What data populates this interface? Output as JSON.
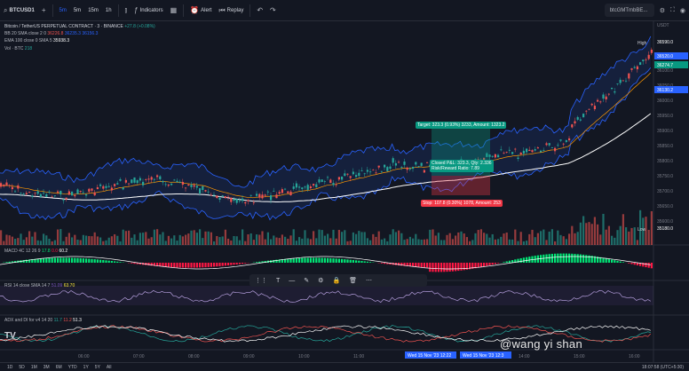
{
  "toolbar": {
    "symbol": "BTCUSD1",
    "intervals": [
      "5m",
      "5m",
      "15m",
      "1h"
    ],
    "indicators": "Indicators",
    "alert": "Alert",
    "replay": "Replay",
    "search": "btcGMTmbBE...",
    "icons": [
      "menu-icon",
      "candles-icon",
      "layout-icon",
      "undo-icon",
      "redo-icon",
      "settings-icon",
      "fullscreen-icon",
      "camera-icon"
    ]
  },
  "legend": {
    "title": "Bitcoin / TetherUS PERPETUAL CONTRACT · 3 · BINANCE",
    "title_change": "+27.8 (+0.08%)",
    "bb": "BB  20 SMA close 2 0",
    "bb_vals": [
      "36226.8",
      "36235.3",
      "36156.3"
    ],
    "ema": "EMA  100 close 0 SMA 5",
    "ema_val": "35938.3",
    "vol": "Vol · BTC",
    "vol_val": "218"
  },
  "macd": {
    "label": "MACD 4C  12 26 9",
    "vals": [
      "17.8",
      "0.0",
      "60.2"
    ]
  },
  "rsi": {
    "label": "RSI  14 close SMA 14 7",
    "vals": [
      "51.09",
      "63.70"
    ]
  },
  "adx": {
    "label": "ADX and DI for v4  14 20",
    "vals": [
      "11.7",
      "11.2",
      "51.3"
    ]
  },
  "trade": {
    "target": "Target: 323.3 (0.93%) 3233, Amount: 1323.2",
    "closed": "Closed P&L: 323.3, Qty: 2.336",
    "ratio": "Risk/Reward Ratio: 7.89",
    "stop": "Stop: 107.8 (0.30%) 1078, Amount: 253"
  },
  "price_axis": [
    "USDT",
    "36200.0",
    "36150.0",
    "36100.0",
    "36050.0",
    "36000.0",
    "35950.0",
    "35900.0",
    "35850.0",
    "35800.0",
    "35750.0",
    "35700.0",
    "35650.0",
    "35600.0"
  ],
  "price_labels": {
    "high": "High",
    "high_val": "36590.0",
    "p1": "36520.0",
    "p2": "36274.7",
    "p3": "36130.2",
    "low": "Low",
    "low_val": "35180.0"
  },
  "time_axis": [
    "06:00",
    "07:00",
    "08:00",
    "09:00",
    "10:00",
    "11:00",
    "12:00",
    "13:00",
    "14:00",
    "15:00",
    "16:00"
  ],
  "time_marks": [
    "Wed 15 Nov '23  12:22",
    "Wed 15 Nov '23  12:3"
  ],
  "ranges": [
    "1D",
    "5D",
    "1M",
    "3M",
    "6M",
    "YTD",
    "1Y",
    "5Y",
    "All"
  ],
  "clock": "18:07:58 (UTC+5:30)",
  "watermark": "@wang yi shan",
  "colors": {
    "up": "#26a69a",
    "down": "#ef5350",
    "bb": "#2962ff",
    "ema": "#ffffff",
    "macd_up": "#00e676",
    "macd_down": "#ff1744"
  }
}
